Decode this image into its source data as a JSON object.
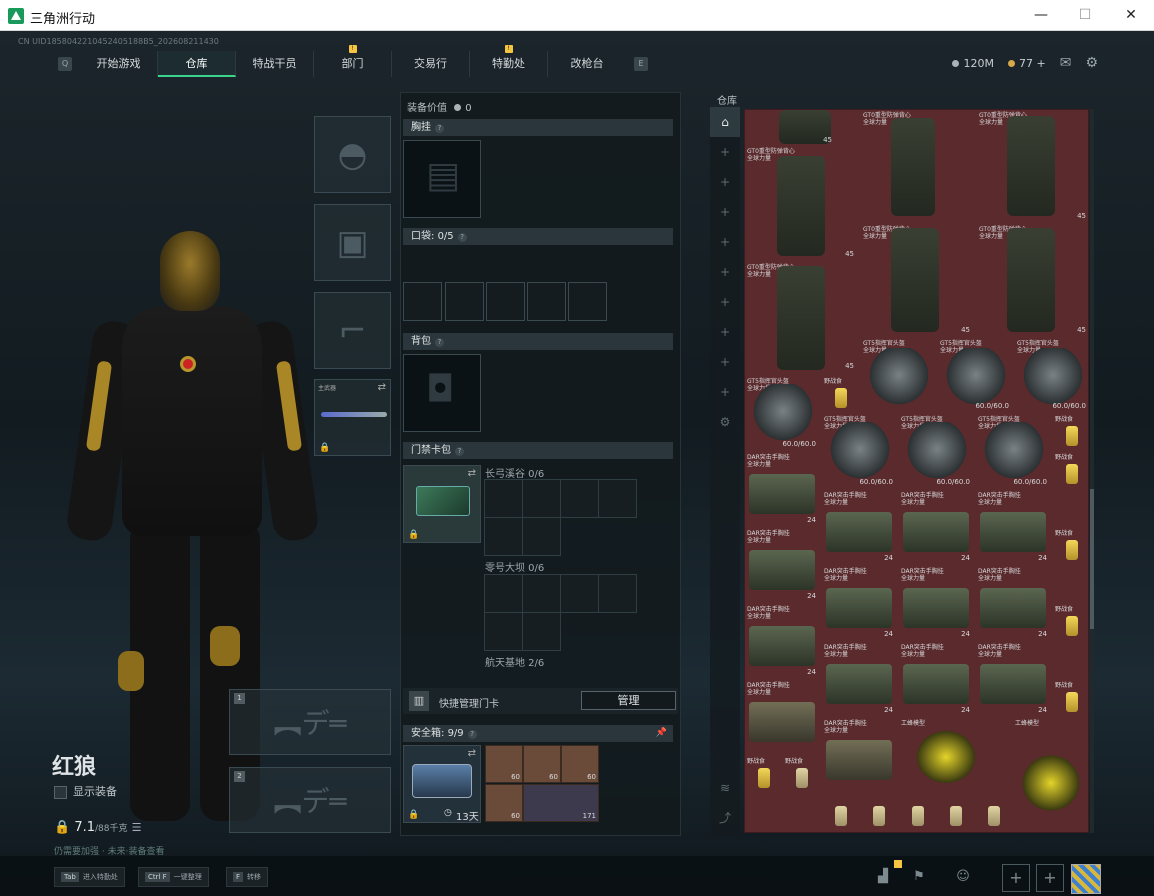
{
  "window": {
    "title": "三角洲行动",
    "minimize": "—",
    "maximize": "☐",
    "close": "✕"
  },
  "uid": "CN UID1858042210452405188B5_202608211430",
  "nav": {
    "left_key": "Q",
    "right_key": "E",
    "tabs": [
      "开始游戏",
      "仓库",
      "特战干员",
      "部门",
      "交易行",
      "特勤处",
      "改枪台"
    ],
    "notice": "!"
  },
  "currency": {
    "silver": "120M",
    "gold": "77",
    "gold_plus": "+"
  },
  "operator": {
    "name": "红狼",
    "show_equipment": "显示装备",
    "weight": "7.1",
    "weight_max": "/88千克",
    "footer_line": "仍需要加强 · 未来·装备查看"
  },
  "equipment": {
    "value_label": "装备价值",
    "value": "0",
    "chest_rig": "胸挂",
    "pockets": "口袋:",
    "pockets_count": "0/5",
    "backpack": "背包",
    "keycard_bag": "门禁卡包",
    "card_cat1": "长弓溪谷 0/6",
    "card_cat2": "零号大坝 0/6",
    "card_cat3": "航天基地 2/6",
    "quick_manage": "快捷管理门卡",
    "manage_button": "管理",
    "safebox": "安全箱:",
    "safebox_count": "9/9",
    "safebox_timer": "13天",
    "help": "?",
    "side_weapon": "主武器",
    "safebox_items": [
      {
        "label": "60"
      },
      {
        "label": "60"
      },
      {
        "label": "60"
      },
      {
        "label": "60"
      },
      {
        "label": "171"
      }
    ]
  },
  "warehouse": {
    "title": "仓库",
    "items": [
      {
        "name": "GT0重型防弹背心\n全球力量",
        "count": "45",
        "kind": "bp"
      },
      {
        "name": "GT5指挥官头盔\n全球力量",
        "count": "60.0/60.0",
        "kind": "helm"
      },
      {
        "name": "DAR突击手胸挂\n全球力量",
        "count": "24",
        "kind": "rig"
      },
      {
        "name": "野战食",
        "count": "",
        "kind": "drink"
      },
      {
        "name": "工蜂模型",
        "count": "",
        "kind": "wasp"
      }
    ]
  },
  "bottom": {
    "hints": [
      {
        "key": "Tab",
        "label": "进入特勤处"
      },
      {
        "key": "Ctrl F",
        "label": "一键整理"
      },
      {
        "key": "F",
        "label": "转移"
      }
    ]
  },
  "colors": {
    "accent": "#3cd38a",
    "warehouse_bg": "#5b2a2d",
    "notice": "#f5c542"
  }
}
